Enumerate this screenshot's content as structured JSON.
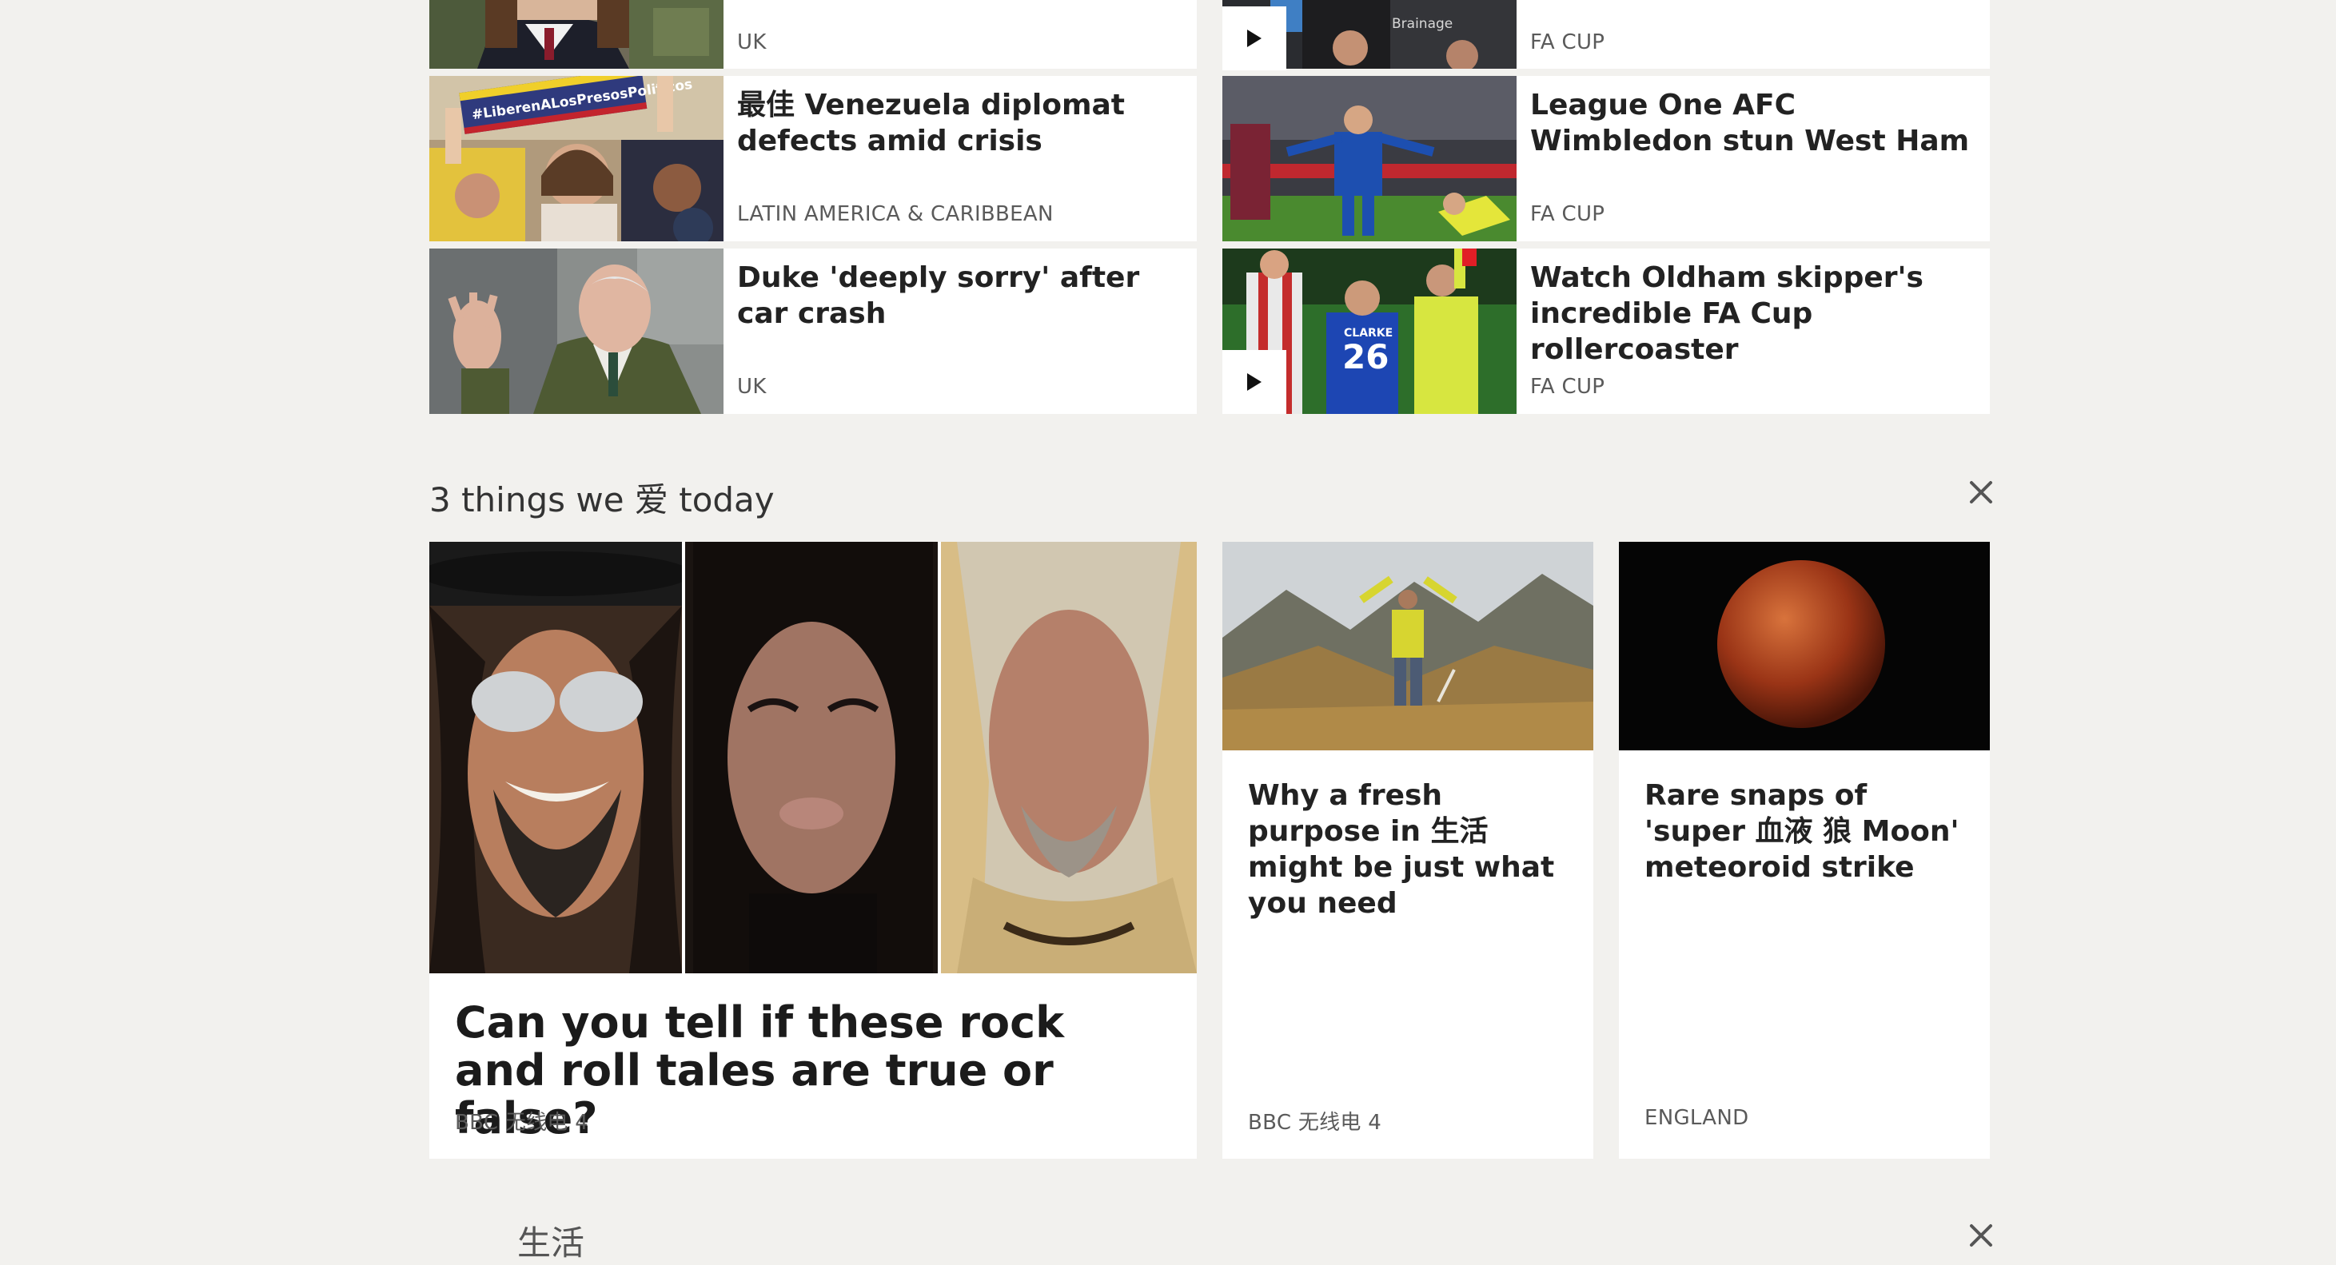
{
  "top_stories": {
    "left": [
      {
        "headline": "",
        "tag": "UK"
      },
      {
        "headline": "最佳 Venezuela diplomat defects amid crisis",
        "tag": "LATIN AMERICA & CARIBBEAN"
      },
      {
        "headline": "Duke 'deeply sorry' after car crash",
        "tag": "UK"
      }
    ],
    "right": [
      {
        "headline": "",
        "tag": "FA CUP",
        "has_play": true,
        "image_text": "Brainage"
      },
      {
        "headline": "League One AFC Wimbledon stun West Ham",
        "tag": "FA CUP"
      },
      {
        "headline": "Watch Oldham skipper's incredible FA Cup rollercoaster",
        "tag": "FA CUP",
        "has_play": true
      }
    ],
    "protest_sign": "#LiberenALosPresosPoliticos",
    "jersey_number": "26",
    "jersey_name": "CLARKE"
  },
  "three_things": {
    "title": "3 things we 爱 today",
    "close_icon": "close-icon",
    "main": {
      "headline": "Can you tell if these rock and roll tales are true or false?",
      "tag": "BBC 无线电 4"
    },
    "second": {
      "headline": "Why a fresh purpose in 生活 might be just what you need",
      "tag": "BBC 无线电 4"
    },
    "third": {
      "headline": "Rare snaps of 'super 血液 狼 Moon' meteoroid strike",
      "tag": "ENGLAND"
    }
  },
  "next_section": {
    "title_partial": "生活"
  },
  "colors": {
    "page_bg": "#f2f1ee",
    "card_bg": "#ffffff",
    "tag_text": "#5a5a5a"
  }
}
